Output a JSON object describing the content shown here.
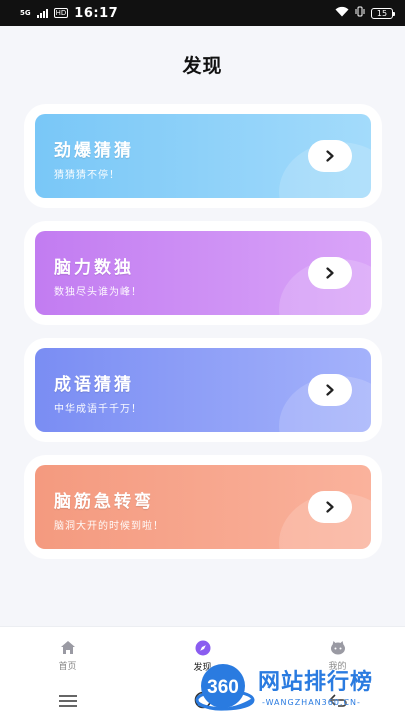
{
  "status_bar": {
    "network": "5G",
    "hd": "HD",
    "time": "16:17",
    "battery": "15"
  },
  "header": {
    "title": "发现"
  },
  "cards": [
    {
      "title": "劲爆猜猜",
      "subtitle": "猜猜猜不停！",
      "color": "#79c7f7"
    },
    {
      "title": "脑力数独",
      "subtitle": "数独尽头谁为峰！",
      "color": "#c27cf1"
    },
    {
      "title": "成语猜猜",
      "subtitle": "中华成语千千万！",
      "color": "#7a8df3"
    },
    {
      "title": "脑筋急转弯",
      "subtitle": "脑洞大开的时候到啦！",
      "color": "#f49a7f"
    }
  ],
  "bottom_nav": {
    "items": [
      {
        "label": "首页",
        "icon": "home-icon"
      },
      {
        "label": "发现",
        "icon": "compass-icon",
        "active": true
      },
      {
        "label": "我的",
        "icon": "profile-icon"
      }
    ]
  },
  "watermark": {
    "badge": "360",
    "text": "网站排行榜",
    "url": "-WANGZHAN360.CN-",
    "color": "#2a7be0"
  }
}
